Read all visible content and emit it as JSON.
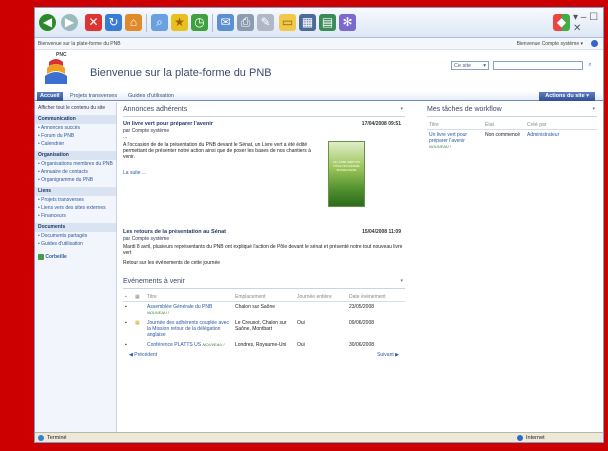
{
  "status_bar": {
    "left": "Terminé",
    "right": "Internet"
  },
  "top_bar": {
    "breadcrumb": "Bienvenue sur la plate-forme du PNB",
    "user_menu": "Bienvenue Compte système ▾"
  },
  "header": {
    "logo_text": "PNC",
    "title": "Bienvenue sur la plate-forme du PNB",
    "search_scope": "Ce site",
    "search_scope_arrow": "▾",
    "search_go": "⌕"
  },
  "nav": {
    "tabs": [
      "Accueil",
      "Projets transverses",
      "Guides d'utilisation"
    ],
    "site_actions": "Actions du site ▾"
  },
  "sidebar": {
    "view_all": "Afficher tout le contenu du site",
    "sections": [
      {
        "title": "Communication",
        "items": [
          "• Annonces succès",
          "• Forum du PNB",
          "• Calendrier"
        ]
      },
      {
        "title": "Organisation",
        "items": [
          "• Organisations membres du PNB",
          "• Annuaire de contacts",
          "• Organigramme du PNB"
        ]
      },
      {
        "title": "Liens",
        "items": [
          "• Projets transverses",
          "• Liens vers des sites externes",
          "• Financeurs"
        ]
      },
      {
        "title": "Documents",
        "items": [
          "• Documents partagés",
          "• Guides d'utilisation"
        ]
      }
    ],
    "recycle_bin": "Corbeille"
  },
  "announcements": {
    "title": "Annonces adhérents",
    "arrow": "▾",
    "items": [
      {
        "title": "Un livre vert pour préparer l'avenir",
        "date": "17/04/2008 09:51",
        "author": "par Compte système",
        "ellipsis": "...",
        "body": "A l'occasion de de la présentation du PNB devant le Sénat, un Livre vert a été édité permettant de présenter notre action ainsi que de poser les bases de nos chantiers à venir.",
        "more": "La suite ..."
      },
      {
        "title": "Les retours de la présentation au Sénat",
        "date": "15/04/2008 11:09",
        "author": "par Compte système",
        "body": "Mardi 8 avril, plusieurs représentants du PNB ont expliqué l'action de Pôle devant le sénat et présenté notre tout nouveau livre vert",
        "more": "Retour sur les événements de cette journée"
      }
    ],
    "book_text": "LE LIVRE VERT DU PÔLE NUCLÉAIRE BOURGOGNE"
  },
  "events": {
    "title": "Evénements à venir",
    "arrow": "▾",
    "columns": [
      "Titre",
      "Emplacement",
      "Journée entière",
      "Date événement"
    ],
    "rows": [
      {
        "title": "Assemblée Générale du PNB",
        "new": "NOUVEAU !",
        "location": "Chalon sur Saône",
        "allday": "",
        "date": "23/05/2008"
      },
      {
        "title": "Journée des adhérents couplée avec la Mission retour de la délégation anglaise",
        "new": "",
        "location": "Le Creusot, Chalon sur Saône, Montbart",
        "allday": "Oui",
        "date": "09/06/2008"
      },
      {
        "title": "Conférence PLATTS US",
        "new": "NOUVEAU !",
        "location": "Londres, Royaume-Uni",
        "allday": "Oui",
        "date": "30/06/2008"
      }
    ],
    "prev": "Précédent",
    "next": "Suivant"
  },
  "workflow": {
    "title": "Mes tâches de workflow",
    "arrow": "▾",
    "columns": [
      "Titre",
      "État",
      "Créé par"
    ],
    "rows": [
      {
        "title": "Un livre vert pour préparer l'avenir",
        "new": "NOUVEAU !",
        "state": "Non commencé",
        "creator": "Administrateur"
      }
    ]
  },
  "window_controls": "▾ – ☐ ✕"
}
